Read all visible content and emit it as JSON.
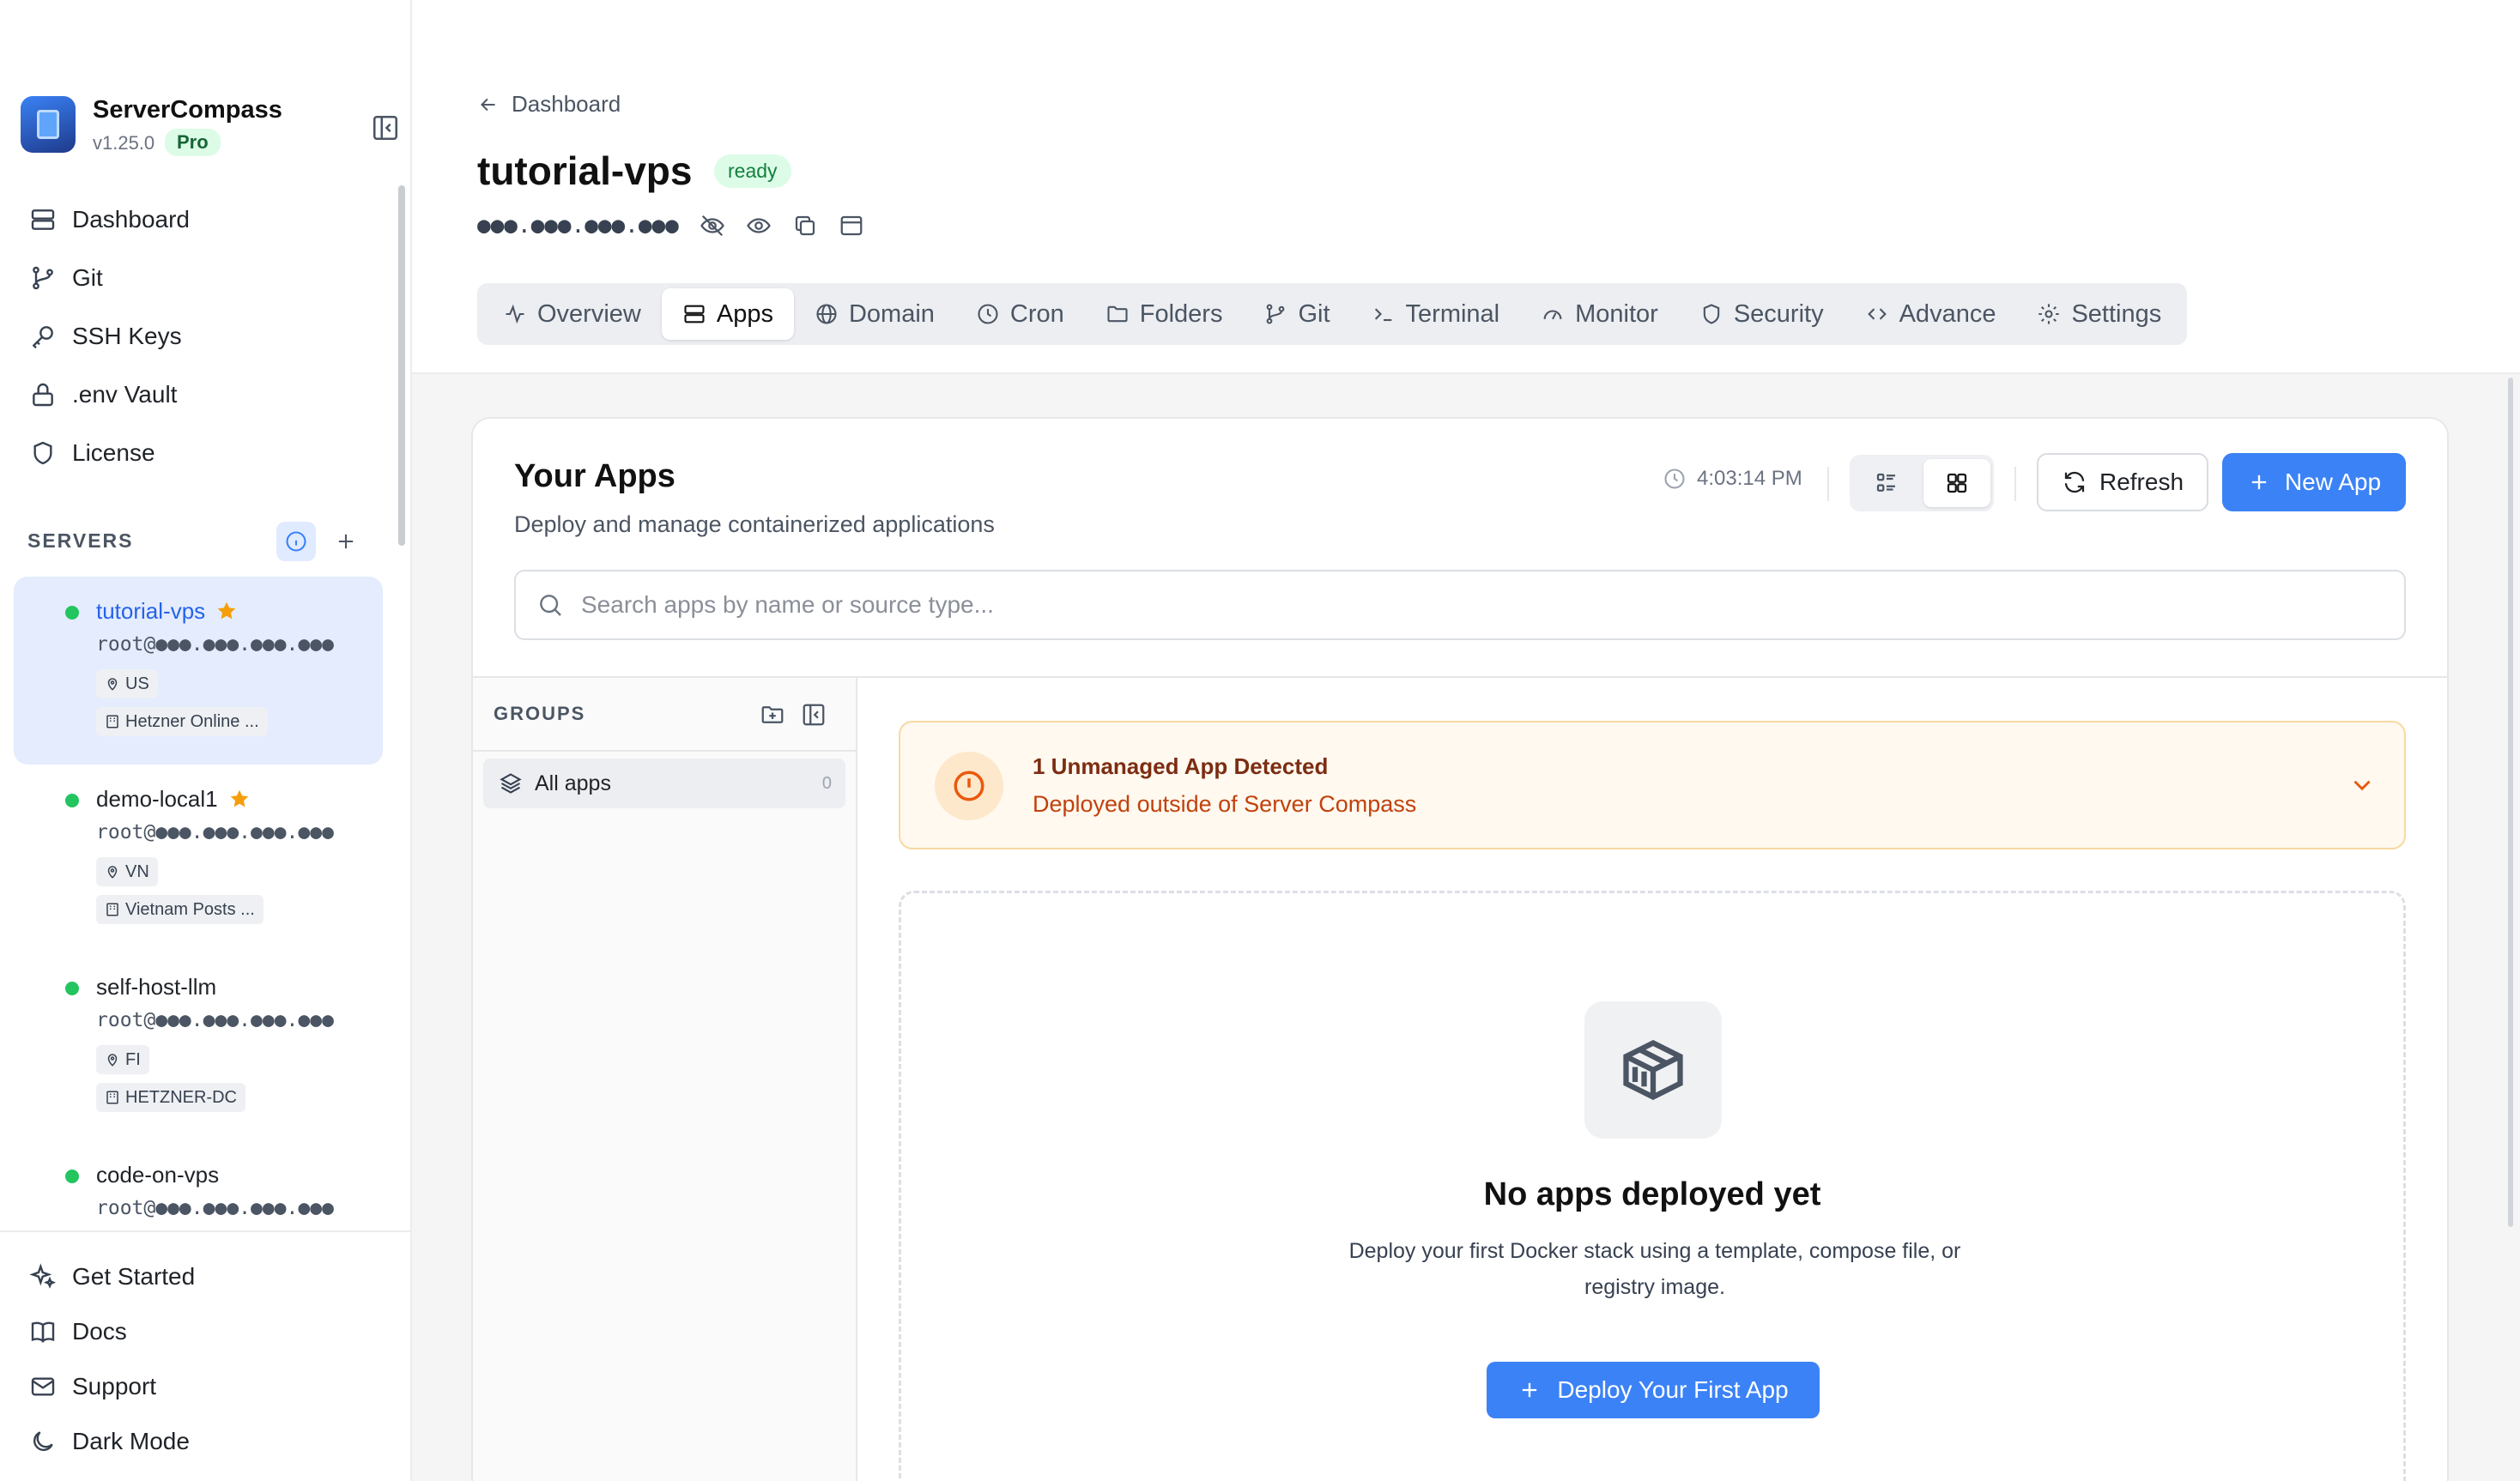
{
  "brand": {
    "name": "ServerCompass",
    "version": "v1.25.0",
    "badge": "Pro"
  },
  "nav": [
    {
      "label": "Dashboard",
      "icon": "server-stack-icon"
    },
    {
      "label": "Git",
      "icon": "git-branch-icon"
    },
    {
      "label": "SSH Keys",
      "icon": "key-icon"
    },
    {
      "label": ".env Vault",
      "icon": "lock-icon"
    },
    {
      "label": "License",
      "icon": "shield-icon"
    }
  ],
  "servers_title": "SERVERS",
  "servers": [
    {
      "name": "tutorial-vps",
      "starred": true,
      "user": "root@●●●.●●●.●●●.●●●",
      "location": "US",
      "provider": "Hetzner Online ...",
      "active": true
    },
    {
      "name": "demo-local1",
      "starred": true,
      "user": "root@●●●.●●●.●●●.●●●",
      "location": "VN",
      "provider": "Vietnam Posts ...",
      "active": false
    },
    {
      "name": "self-host-llm",
      "starred": false,
      "user": "root@●●●.●●●.●●●.●●●",
      "location": "FI",
      "provider": "HETZNER-DC",
      "active": false
    },
    {
      "name": "code-on-vps",
      "starred": false,
      "user": "root@●●●.●●●.●●●.●●●",
      "location": "",
      "provider": "",
      "active": false
    }
  ],
  "bottom_nav": [
    {
      "label": "Get Started",
      "icon": "sparkle-icon"
    },
    {
      "label": "Docs",
      "icon": "book-icon"
    },
    {
      "label": "Support",
      "icon": "mail-icon"
    },
    {
      "label": "Dark Mode",
      "icon": "moon-icon"
    }
  ],
  "header": {
    "back_label": "Dashboard",
    "title": "tutorial-vps",
    "status": "ready",
    "ip": "●●●.●●●.●●●.●●●"
  },
  "tabs": [
    {
      "label": "Overview",
      "icon": "activity-icon",
      "active": false
    },
    {
      "label": "Apps",
      "icon": "server-stack-icon",
      "active": true
    },
    {
      "label": "Domain",
      "icon": "globe-icon",
      "active": false
    },
    {
      "label": "Cron",
      "icon": "clock-icon",
      "active": false
    },
    {
      "label": "Folders",
      "icon": "folder-icon",
      "active": false
    },
    {
      "label": "Git",
      "icon": "git-branch-icon",
      "active": false
    },
    {
      "label": "Terminal",
      "icon": "terminal-icon",
      "active": false
    },
    {
      "label": "Monitor",
      "icon": "gauge-icon",
      "active": false
    },
    {
      "label": "Security",
      "icon": "shield-icon",
      "active": false
    },
    {
      "label": "Advance",
      "icon": "code-icon",
      "active": false
    },
    {
      "label": "Settings",
      "icon": "gear-icon",
      "active": false
    }
  ],
  "apps": {
    "title": "Your Apps",
    "subtitle": "Deploy and manage containerized applications",
    "time": "4:03:14 PM",
    "refresh_label": "Refresh",
    "new_app_label": "New App",
    "search_placeholder": "Search apps by name or source type...",
    "search_value": ""
  },
  "groups": {
    "title": "GROUPS",
    "items": [
      {
        "label": "All apps",
        "count": "0"
      }
    ]
  },
  "alert": {
    "title": "1 Unmanaged App Detected",
    "subtitle": "Deployed outside of Server Compass"
  },
  "empty": {
    "title": "No apps deployed yet",
    "subtitle": "Deploy your first Docker stack using a template, compose file, or registry image.",
    "button_label": "Deploy Your First App"
  },
  "colors": {
    "accent": "#3b82f6",
    "active_bg": "#e4ecfd",
    "online": "#22c55e",
    "warning": "#c2410c",
    "star": "#f59e0b"
  }
}
